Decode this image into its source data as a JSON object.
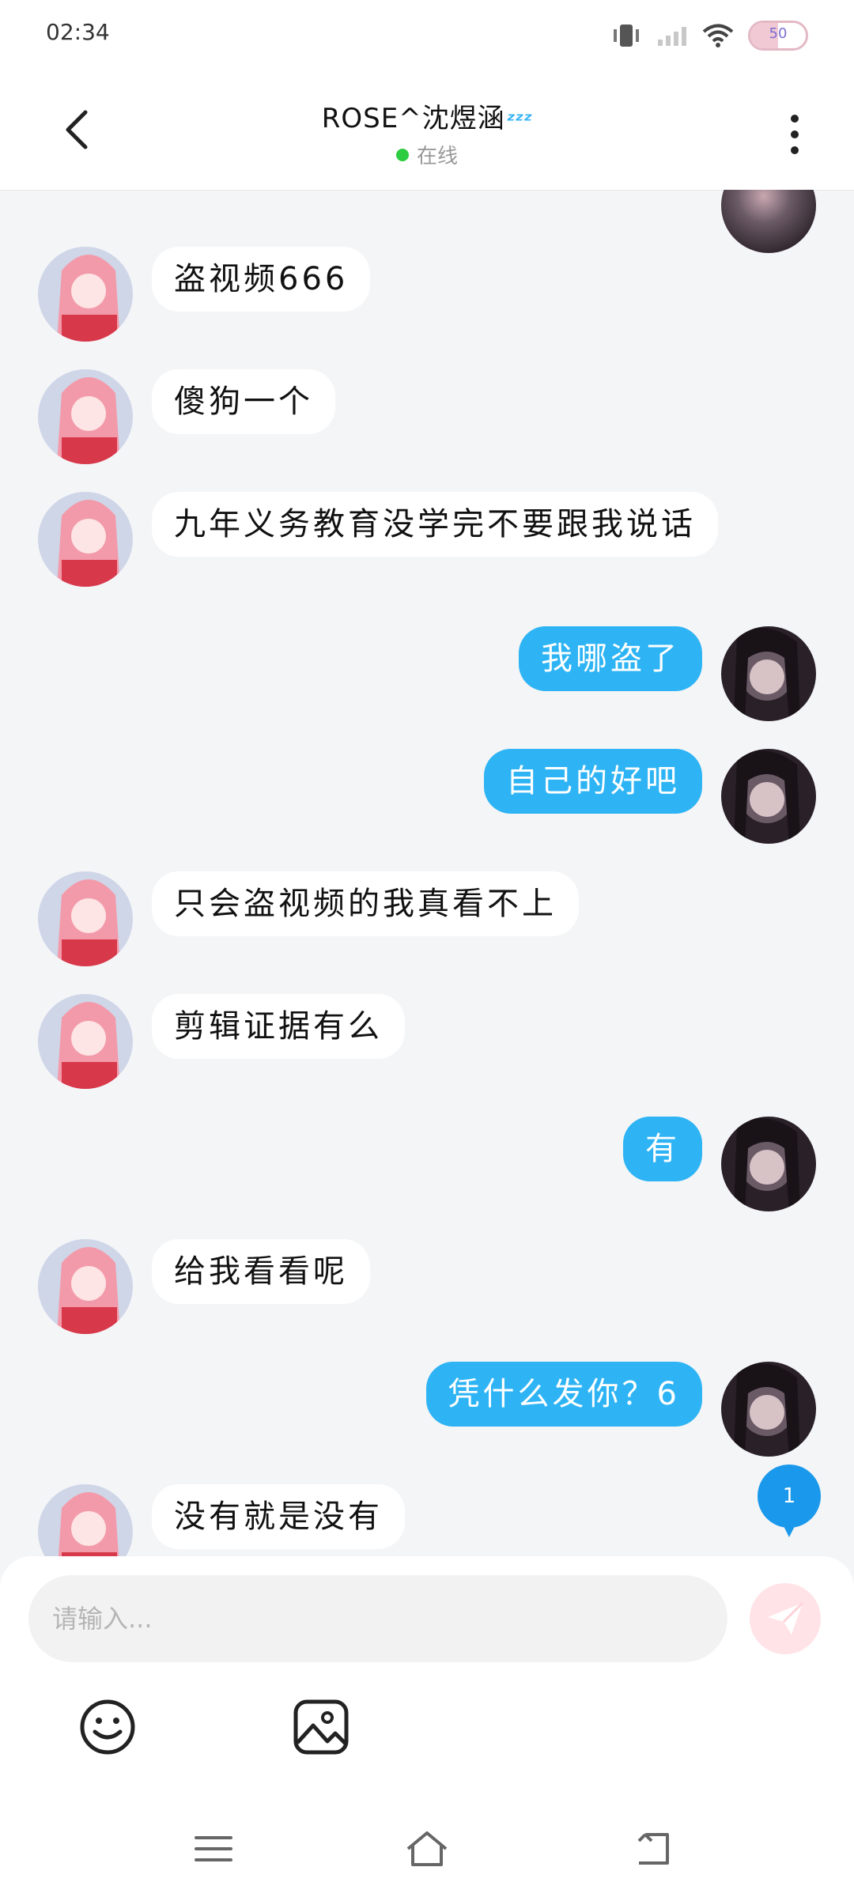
{
  "status": {
    "time": "02:34",
    "battery": "50"
  },
  "header": {
    "title": "ROSE^沈煜涵",
    "title_emoji": "ᶻᶻᶻ",
    "presence": "在线"
  },
  "messages": [
    {
      "side": "in",
      "text": "盗视频666"
    },
    {
      "side": "in",
      "text": "傻狗一个"
    },
    {
      "side": "in",
      "text": "九年义务教育没学完不要跟我说话"
    },
    {
      "side": "out",
      "text": "我哪盗了"
    },
    {
      "side": "out",
      "text": "自己的好吧"
    },
    {
      "side": "in",
      "text": "只会盗视频的我真看不上"
    },
    {
      "side": "in",
      "text": "剪辑证据有么"
    },
    {
      "side": "out",
      "text": "有"
    },
    {
      "side": "in",
      "text": "给我看看呢"
    },
    {
      "side": "out",
      "text": "凭什么发你？6"
    },
    {
      "side": "in",
      "text": "没有就是没有"
    }
  ],
  "unread_badge": "1",
  "composer": {
    "placeholder": "请输入...",
    "send_icon": "paper-plane-icon",
    "emoji_icon": "smiley-icon",
    "image_icon": "image-icon"
  },
  "navbar": {
    "items": [
      "menu-icon",
      "home-icon",
      "back-icon"
    ]
  },
  "colors": {
    "outgoing_bubble": "#2eb4f4",
    "incoming_bubble": "#ffffff",
    "background": "#f4f5f7",
    "online": "#2ecc40"
  }
}
